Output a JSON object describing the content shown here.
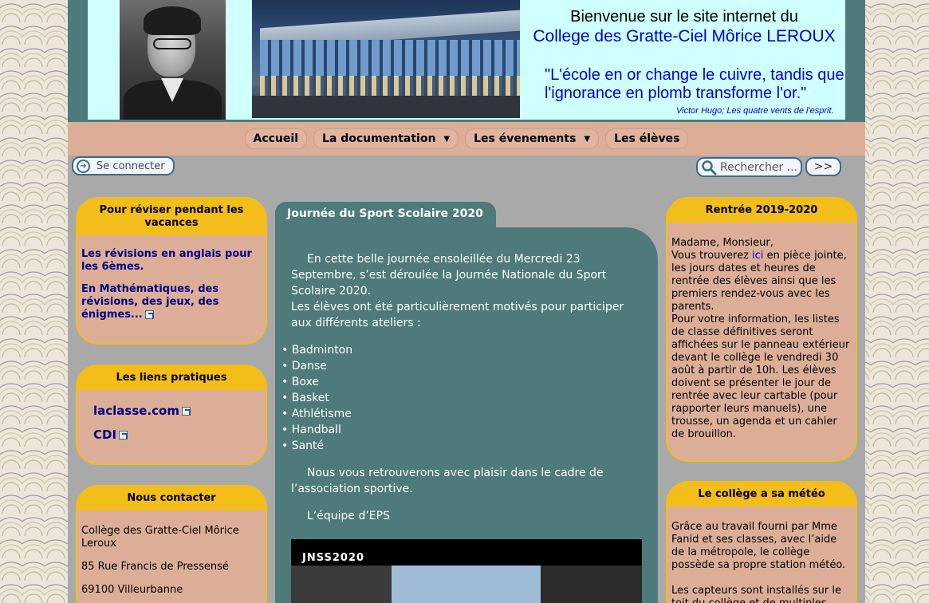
{
  "header": {
    "welcome_line1": "Bienvenue sur le site internet du",
    "welcome_line2": "College des Gratte-Ciel Môrice LEROUX",
    "quote": "\"L'école en or change le cuivre, tandis que l'ignorance en plomb transforme l'or.\"",
    "quote_author": "Victor Hugo; Les quatre vents de l'esprit."
  },
  "nav": {
    "items": [
      {
        "label": "Accueil",
        "has_dropdown": false
      },
      {
        "label": "La documentation",
        "has_dropdown": true
      },
      {
        "label": "Les évenements",
        "has_dropdown": true
      },
      {
        "label": "Les élèves",
        "has_dropdown": false
      }
    ]
  },
  "toolbar": {
    "login_label": "Se connecter",
    "search_placeholder": "Rechercher ...",
    "search_button": ">>"
  },
  "left": {
    "revision": {
      "title": "Pour réviser pendant les vacances",
      "links": [
        "Les révisions en anglais pour les 6èmes.",
        "En Mathématiques, des révisions, des jeux, des énigmes..."
      ]
    },
    "links": {
      "title": "Les liens pratiques",
      "items": [
        "laclasse.com",
        "CDI"
      ]
    },
    "contact": {
      "title": "Nous contacter",
      "name": "Collège des Gratte-Ciel Môrice Leroux",
      "address": "85 Rue Francis de Pressensé",
      "city": "69100 Villeurbanne"
    }
  },
  "article": {
    "title": "Journée du Sport Scolaire 2020",
    "intro": "En cette belle journée ensoleillée du Mercredi 23 Septembre, s’est déroulée la Journée Nationale du Sport Scolaire 2020.",
    "motivated": "Les élèves ont été particulièrement motivés pour participer aux différents ateliers :",
    "activities": [
      "Badminton",
      "Danse",
      "Boxe",
      "Basket",
      "Athlétisme",
      "Handball",
      "Santé"
    ],
    "closing": "Nous vous retrouverons avec plaisir dans le cadre de l’association sportive.",
    "signature": "L’équipe d’EPS",
    "video_title": "JNSS2020"
  },
  "right": {
    "rentree": {
      "title": "Rentrée 2019-2020",
      "greeting": "Madame, Monsieur,",
      "text_before_link": "Vous trouverez ",
      "link": "ici",
      "text_after_link": " en pièce jointe, les jours dates et heures de rentrée des élèves ainsi que les premiers rendez-vous avec les parents.",
      "info": "Pour votre information, les listes de classe définitives seront affichées sur le panneau extérieur devant le collège le vendredi 30 août à partir de 10h. Les élèves doivent se présenter le jour de rentrée avec leur cartable (pour rapporter leurs manuels), une trousse, un agenda et un cahier de brouillon."
    },
    "meteo": {
      "title": "Le collège a sa météo",
      "p1": "Grâce au travail fourni par Mme Fanid et ses classes, avec l’aide de la métropole, le collège possède sa propre station météo.",
      "p2": "Les capteurs sont installés sur le toit du collège et de multiples"
    }
  },
  "colors": {
    "teal": "#4e7a7c",
    "header_bg": "#cffffe",
    "nav_bg": "#dcae98",
    "box_title": "#f3bd1a",
    "link_blue": "#000080"
  }
}
